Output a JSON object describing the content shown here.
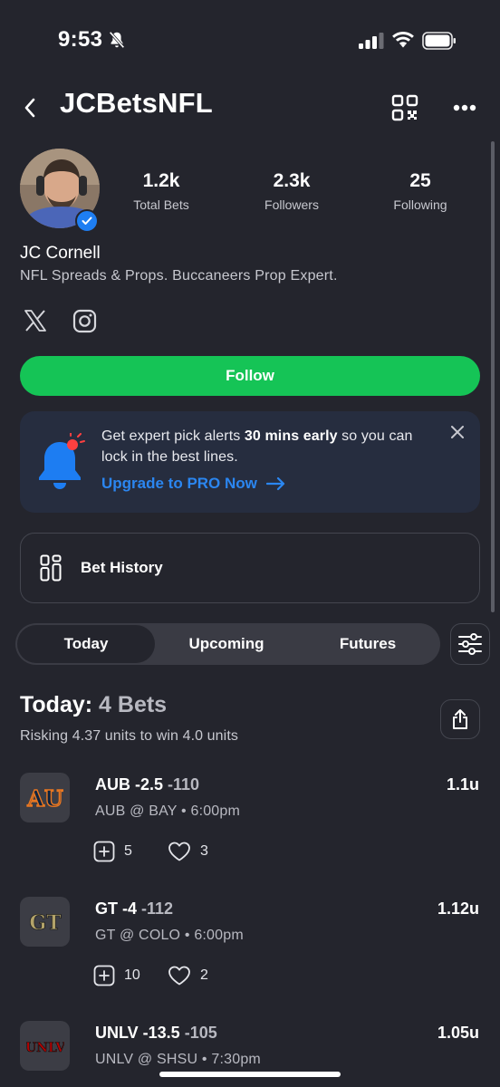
{
  "status_bar": {
    "time": "9:53"
  },
  "header": {
    "title": "JCBetsNFL"
  },
  "profile": {
    "stats": [
      {
        "value": "1.2k",
        "label": "Total Bets"
      },
      {
        "value": "2.3k",
        "label": "Followers"
      },
      {
        "value": "25",
        "label": "Following"
      }
    ],
    "name": "JC Cornell",
    "bio": "NFL Spreads & Props. Buccaneers Prop Expert.",
    "follow_label": "Follow"
  },
  "promo": {
    "text_before": "Get expert pick alerts ",
    "text_bold": "30 mins early",
    "text_after": " so you can lock in the best lines.",
    "link": "Upgrade to PRO Now"
  },
  "history": {
    "label": "Bet History"
  },
  "tabs": [
    {
      "label": "Today",
      "active": true
    },
    {
      "label": "Upcoming",
      "active": false
    },
    {
      "label": "Futures",
      "active": false
    }
  ],
  "today": {
    "title": "Today:",
    "count": "4 Bets",
    "subtitle": "Risking 4.37 units to win 4.0 units"
  },
  "bets": [
    {
      "team_logo": "AU",
      "line": "AUB -2.5",
      "odds": "-110",
      "game": "AUB @ BAY",
      "time": "6:00pm",
      "units": "1.1u",
      "tails": "5",
      "likes": "3"
    },
    {
      "team_logo": "GT",
      "line": "GT -4",
      "odds": "-112",
      "game": "GT @ COLO",
      "time": "6:00pm",
      "units": "1.12u",
      "tails": "10",
      "likes": "2"
    },
    {
      "team_logo": "UNLV",
      "line": "UNLV -13.5",
      "odds": "-105",
      "game": "UNLV @ SHSU",
      "time": "7:30pm",
      "units": "1.05u"
    }
  ],
  "colors": {
    "accent_green": "#15c456",
    "link_blue": "#2b86f0",
    "background": "#24252d"
  }
}
